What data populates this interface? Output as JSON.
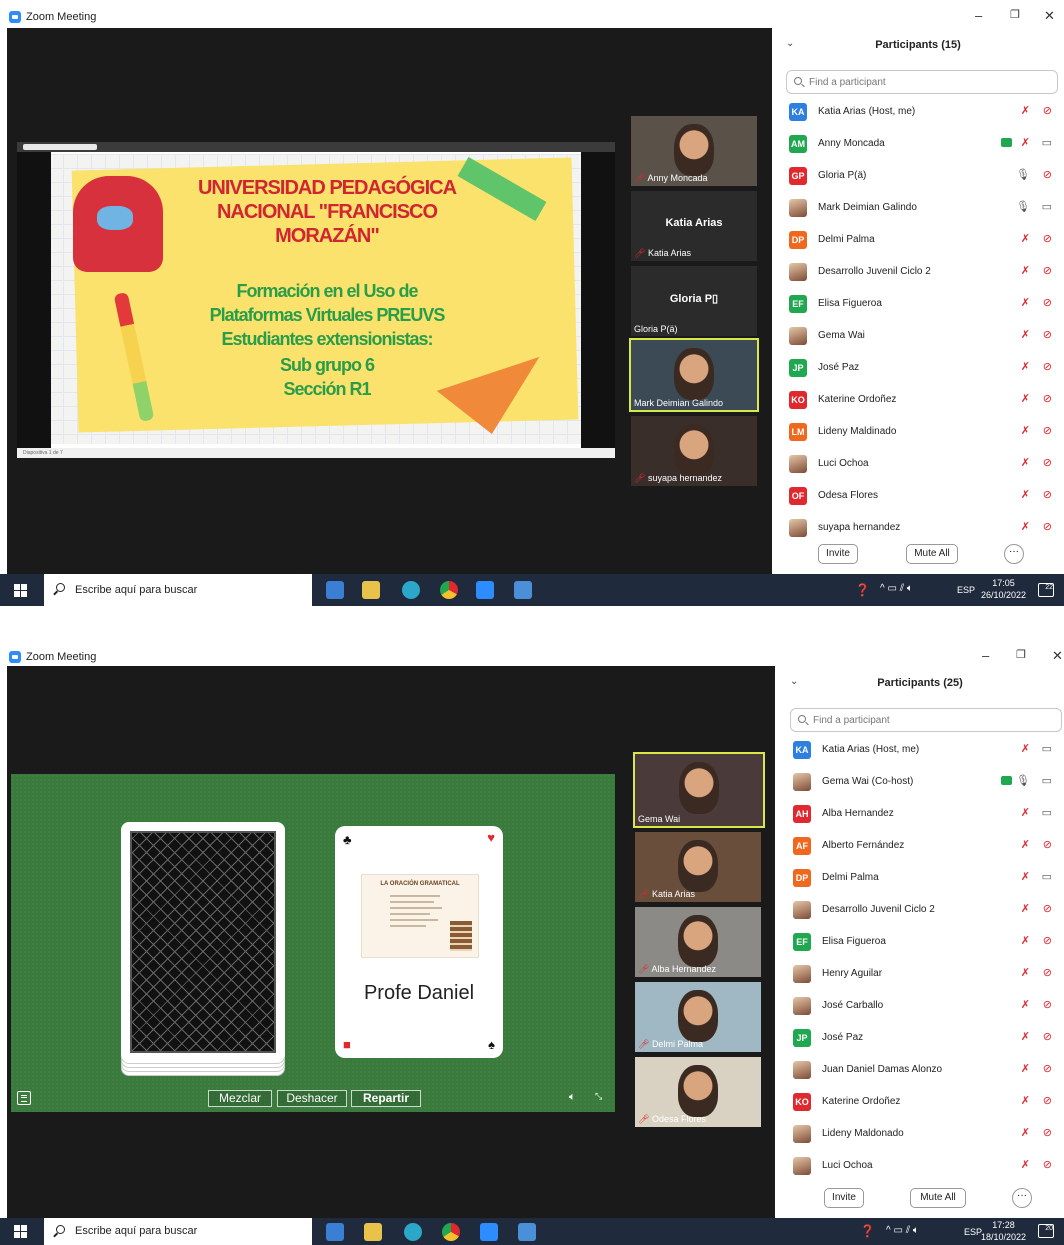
{
  "screen1": {
    "window_title": "Zoom Meeting",
    "panel_title": "Participants (15)",
    "search_placeholder": "Find a participant",
    "participants": [
      {
        "initials": "KA",
        "color": "#2d7fe0",
        "name": "Katia Arias (Host, me)",
        "mic": "muted",
        "cam": "off"
      },
      {
        "initials": "AM",
        "color": "#1fa84f",
        "name": "Anny Moncada",
        "mic": "muted",
        "cam": "on",
        "sharing": true
      },
      {
        "initials": "GP",
        "color": "#e0292f",
        "name": "Gloria P(ä)",
        "mic": "on",
        "cam": "off"
      },
      {
        "initials": "",
        "color": "photo",
        "name": "Mark Deimian Galindo",
        "mic": "on",
        "cam": "on"
      },
      {
        "initials": "DP",
        "color": "#f0681e",
        "name": "Delmi Palma",
        "mic": "muted",
        "cam": "off"
      },
      {
        "initials": "",
        "color": "photo",
        "name": "Desarrollo Juvenil Ciclo 2",
        "mic": "muted",
        "cam": "off"
      },
      {
        "initials": "EF",
        "color": "#1fa84f",
        "name": "Elisa Figueroa",
        "mic": "muted",
        "cam": "off"
      },
      {
        "initials": "",
        "color": "photo",
        "name": "Gema Wai",
        "mic": "muted",
        "cam": "off"
      },
      {
        "initials": "JP",
        "color": "#1fa84f",
        "name": "José Paz",
        "mic": "muted",
        "cam": "off"
      },
      {
        "initials": "KO",
        "color": "#e0292f",
        "name": "Katerine Ordoñez",
        "mic": "muted",
        "cam": "off"
      },
      {
        "initials": "LM",
        "color": "#f0681e",
        "name": "Lideny Maldinado",
        "mic": "muted",
        "cam": "off"
      },
      {
        "initials": "",
        "color": "photo",
        "name": "Luci Ochoa",
        "mic": "muted",
        "cam": "off"
      },
      {
        "initials": "OF",
        "color": "#e0292f",
        "name": "Odesa Flores",
        "mic": "muted",
        "cam": "off"
      },
      {
        "initials": "",
        "color": "photo",
        "name": "suyapa hernandez",
        "mic": "muted",
        "cam": "off"
      }
    ],
    "invite_label": "Invite",
    "mute_all_label": "Mute All",
    "more_label": "···",
    "video_tiles": [
      {
        "name": "Anny Moncada",
        "type": "video"
      },
      {
        "name": "Katia Arias",
        "big": "Katia Arias",
        "type": "name"
      },
      {
        "name": "Gloria P(ä)",
        "big": "Gloria P▯",
        "type": "name"
      },
      {
        "name": "Mark Deimian Galindo",
        "type": "video",
        "active": true
      },
      {
        "name": "suyapa hernandez",
        "type": "video"
      }
    ],
    "slide": {
      "line1": "UNIVERSIDAD PEDAGÓGICA",
      "line2": "NACIONAL \"FRANCISCO",
      "line3": "MORAZÁN\"",
      "line4": "Formación en el Uso de",
      "line5": "Plataformas Virtuales PREUVS",
      "line6": "Estudiantes extensionistas:",
      "line7": "Sub grupo 6",
      "line8": "Sección R1",
      "footer": "Diapositiva 1 de 7"
    },
    "taskbar": {
      "search_text": "Escribe aquí para buscar",
      "lang": "ESP",
      "time": "17:05",
      "date": "26/10/2022",
      "notif": "22"
    }
  },
  "screen2": {
    "window_title": "Zoom Meeting",
    "panel_title": "Participants (25)",
    "search_placeholder": "Find a participant",
    "participants": [
      {
        "initials": "KA",
        "color": "#2d7fe0",
        "name": "Katia Arias (Host, me)",
        "mic": "muted",
        "cam": "on"
      },
      {
        "initials": "",
        "color": "photo",
        "name": "Gema Wai (Co-host)",
        "mic": "on",
        "cam": "on",
        "sharing": true
      },
      {
        "initials": "AH",
        "color": "#e0292f",
        "name": "Alba Hernandez",
        "mic": "muted",
        "cam": "on"
      },
      {
        "initials": "AF",
        "color": "#f0681e",
        "name": "Alberto Fernández",
        "mic": "muted",
        "cam": "off"
      },
      {
        "initials": "DP",
        "color": "#f0681e",
        "name": "Delmi Palma",
        "mic": "muted",
        "cam": "on"
      },
      {
        "initials": "",
        "color": "photo",
        "name": "Desarrollo Juvenil Ciclo 2",
        "mic": "muted",
        "cam": "off"
      },
      {
        "initials": "EF",
        "color": "#1fa84f",
        "name": "Elisa Figueroa",
        "mic": "muted",
        "cam": "off"
      },
      {
        "initials": "",
        "color": "photo",
        "name": "Henry Aguilar",
        "mic": "muted",
        "cam": "off"
      },
      {
        "initials": "",
        "color": "photo",
        "name": "José Carballo",
        "mic": "muted",
        "cam": "off"
      },
      {
        "initials": "JP",
        "color": "#1fa84f",
        "name": "José Paz",
        "mic": "muted",
        "cam": "off"
      },
      {
        "initials": "",
        "color": "photo",
        "name": "Juan Daniel Damas Alonzo",
        "mic": "muted",
        "cam": "off"
      },
      {
        "initials": "KO",
        "color": "#e0292f",
        "name": "Katerine Ordoñez",
        "mic": "muted",
        "cam": "off"
      },
      {
        "initials": "",
        "color": "photo",
        "name": "Lideny Maldonado",
        "mic": "muted",
        "cam": "off"
      },
      {
        "initials": "",
        "color": "photo",
        "name": "Luci Ochoa",
        "mic": "muted",
        "cam": "off"
      }
    ],
    "invite_label": "Invite",
    "mute_all_label": "Mute All",
    "more_label": "···",
    "video_tiles": [
      {
        "name": "Gema Wai",
        "type": "video",
        "active": true
      },
      {
        "name": "Katia Arias",
        "type": "video"
      },
      {
        "name": "Alba Hernandez",
        "type": "video"
      },
      {
        "name": "Delmi Palma",
        "type": "video"
      },
      {
        "name": "Odesa Flores",
        "type": "video"
      }
    ],
    "game": {
      "card_name": "Profe Daniel",
      "mini_title": "LA ORACIÓN GRAMATICAL",
      "btn_shuffle": "Mezclar",
      "btn_undo": "Deshacer",
      "btn_deal": "Repartir"
    },
    "taskbar": {
      "search_text": "Escribe aquí para buscar",
      "lang": "ESP",
      "time": "17:28",
      "date": "18/10/2022",
      "notif": "20"
    }
  }
}
